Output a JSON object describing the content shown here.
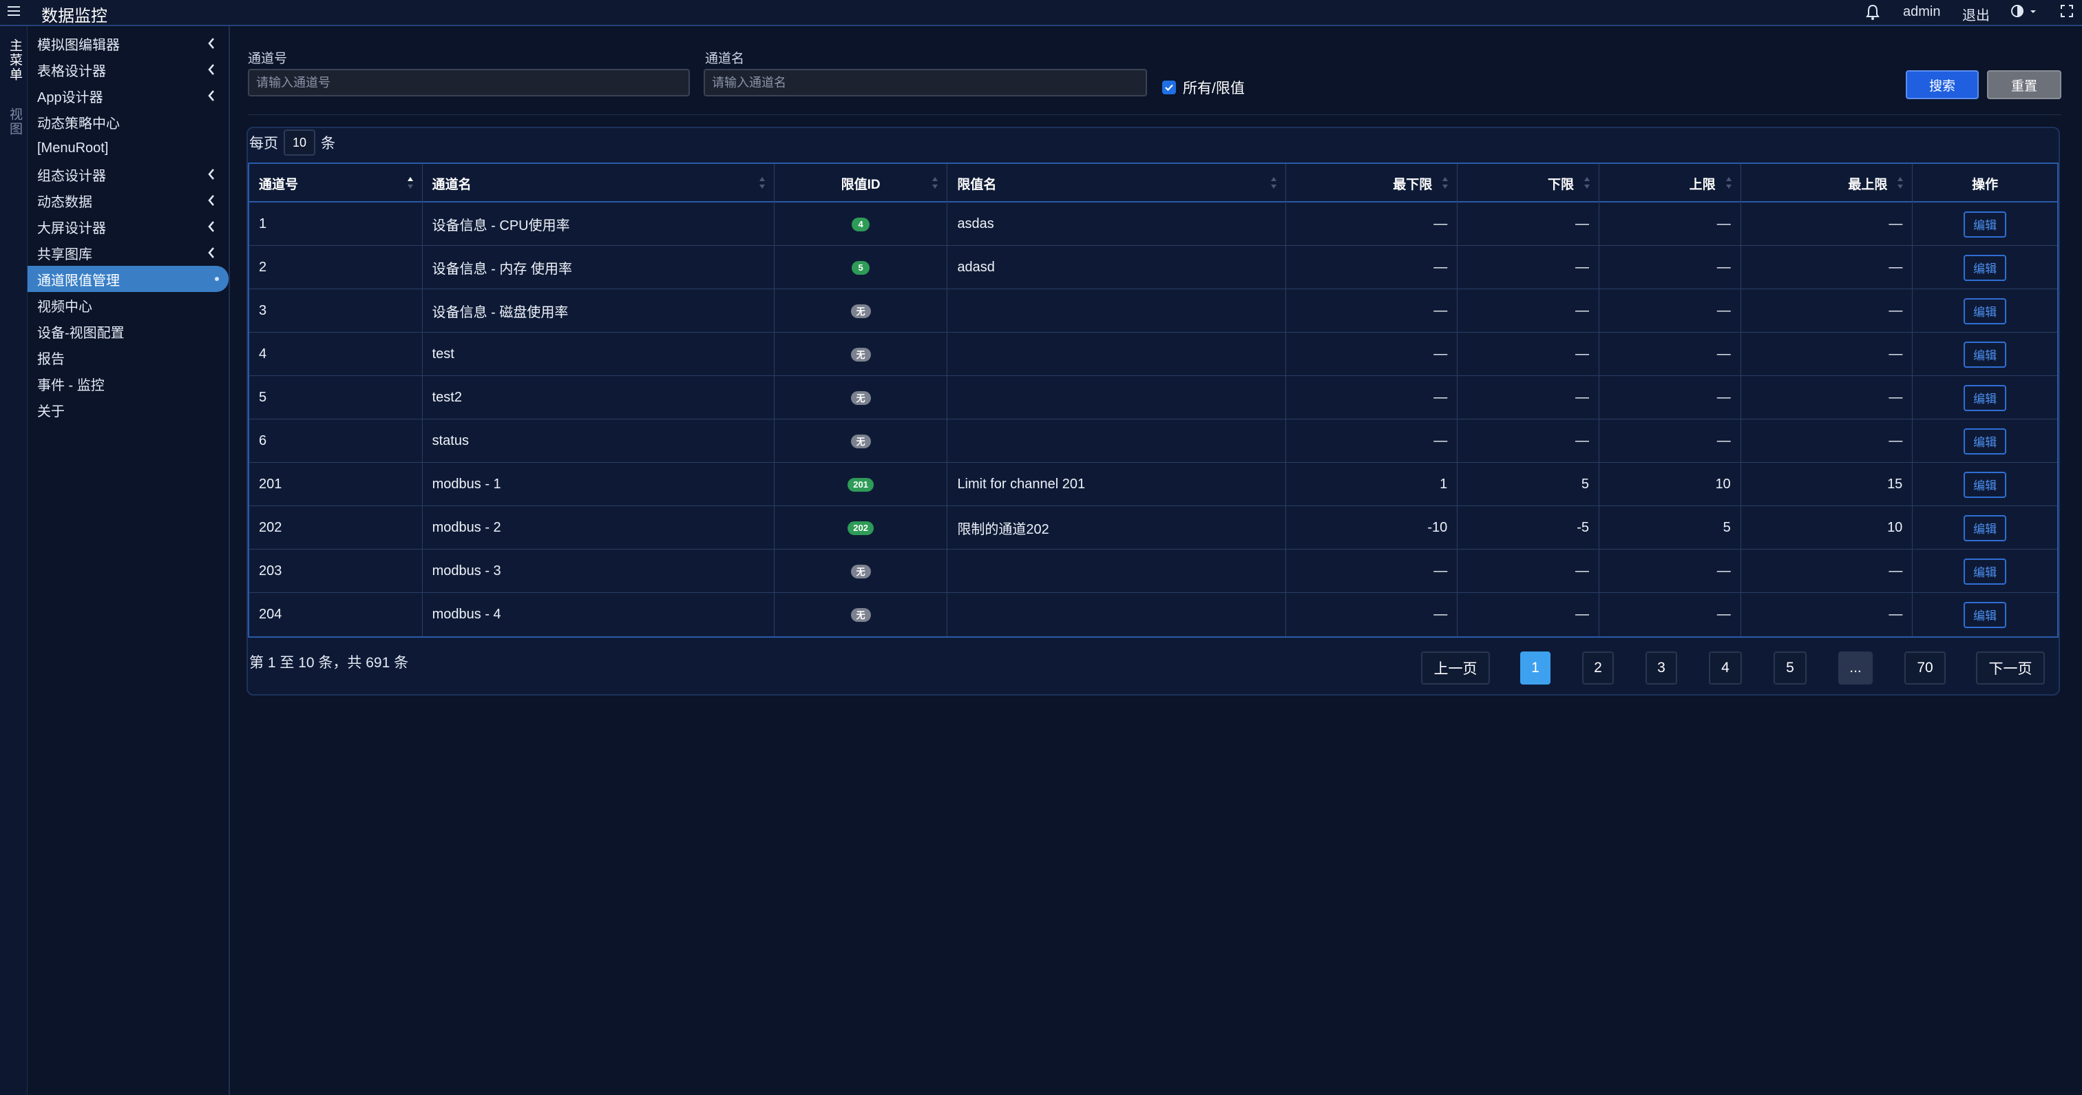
{
  "app": {
    "title": "数据监控",
    "user": "admin",
    "logout": "退出"
  },
  "vtabs": {
    "main": "主菜单",
    "view": "视图"
  },
  "sidebar": {
    "items": [
      {
        "label": "模拟图编辑器",
        "has_children": true
      },
      {
        "label": "表格设计器",
        "has_children": true
      },
      {
        "label": "App设计器",
        "has_children": true
      },
      {
        "label": "动态策略中心",
        "has_children": false
      },
      {
        "label": "[MenuRoot]",
        "has_children": false
      },
      {
        "label": "组态设计器",
        "has_children": true
      },
      {
        "label": "动态数据",
        "has_children": true
      },
      {
        "label": "大屏设计器",
        "has_children": true
      },
      {
        "label": "共享图库",
        "has_children": true
      },
      {
        "label": "通道限值管理",
        "has_children": false,
        "active": true
      },
      {
        "label": "视频中心",
        "has_children": false
      },
      {
        "label": "设备-视图配置",
        "has_children": false
      },
      {
        "label": "报告",
        "has_children": false
      },
      {
        "label": "事件 - 监控",
        "has_children": false
      },
      {
        "label": "关于",
        "has_children": false
      }
    ]
  },
  "filters": {
    "channel_no_label": "通道号",
    "channel_no_placeholder": "请输入通道号",
    "channel_name_label": "通道名",
    "channel_name_placeholder": "请输入通道名",
    "all_limits_label": "所有/限值",
    "all_limits_checked": true,
    "search_button": "搜索",
    "reset_button": "重置"
  },
  "perpage": {
    "prefix": "每页",
    "value": "10",
    "suffix": "条"
  },
  "table": {
    "columns": [
      "通道号",
      "通道名",
      "限值ID",
      "限值名",
      "最下限",
      "下限",
      "上限",
      "最上限",
      "操作"
    ],
    "edit_label": "编辑",
    "rows": [
      {
        "no": "1",
        "name": "设备信息 - CPU使用率",
        "limit_id": "4",
        "limit_id_color": "green",
        "limit_name": "asdas",
        "min_min": "—",
        "min": "—",
        "max": "—",
        "max_max": "—"
      },
      {
        "no": "2",
        "name": "设备信息 - 内存 使用率",
        "limit_id": "5",
        "limit_id_color": "green",
        "limit_name": "adasd",
        "min_min": "—",
        "min": "—",
        "max": "—",
        "max_max": "—"
      },
      {
        "no": "3",
        "name": "设备信息 - 磁盘使用率",
        "limit_id": "无",
        "limit_id_color": "gray",
        "limit_name": "",
        "min_min": "—",
        "min": "—",
        "max": "—",
        "max_max": "—"
      },
      {
        "no": "4",
        "name": "test",
        "limit_id": "无",
        "limit_id_color": "gray",
        "limit_name": "",
        "min_min": "—",
        "min": "—",
        "max": "—",
        "max_max": "—"
      },
      {
        "no": "5",
        "name": "test2",
        "limit_id": "无",
        "limit_id_color": "gray",
        "limit_name": "",
        "min_min": "—",
        "min": "—",
        "max": "—",
        "max_max": "—"
      },
      {
        "no": "6",
        "name": "status",
        "limit_id": "无",
        "limit_id_color": "gray",
        "limit_name": "",
        "min_min": "—",
        "min": "—",
        "max": "—",
        "max_max": "—"
      },
      {
        "no": "201",
        "name": "modbus - 1",
        "limit_id": "201",
        "limit_id_color": "green",
        "limit_name": "Limit for channel 201",
        "min_min": "1",
        "min": "5",
        "max": "10",
        "max_max": "15"
      },
      {
        "no": "202",
        "name": "modbus - 2",
        "limit_id": "202",
        "limit_id_color": "green",
        "limit_name": "限制的通道202",
        "min_min": "-10",
        "min": "-5",
        "max": "5",
        "max_max": "10"
      },
      {
        "no": "203",
        "name": "modbus - 3",
        "limit_id": "无",
        "limit_id_color": "gray",
        "limit_name": "",
        "min_min": "—",
        "min": "—",
        "max": "—",
        "max_max": "—"
      },
      {
        "no": "204",
        "name": "modbus - 4",
        "limit_id": "无",
        "limit_id_color": "gray",
        "limit_name": "",
        "min_min": "—",
        "min": "—",
        "max": "—",
        "max_max": "—"
      }
    ]
  },
  "pagination": {
    "summary": "第 1 至 10 条，共 691 条",
    "prev": "上一页",
    "next": "下一页",
    "pages": [
      "1",
      "2",
      "3",
      "4",
      "5",
      "...",
      "70"
    ],
    "current": "1"
  },
  "colors": {
    "accent": "#1f5fe0",
    "active_nav": "#3a7fc6",
    "badge_green": "#2e9b57",
    "badge_gray": "#7d8290",
    "current_page": "#3da1f0"
  }
}
